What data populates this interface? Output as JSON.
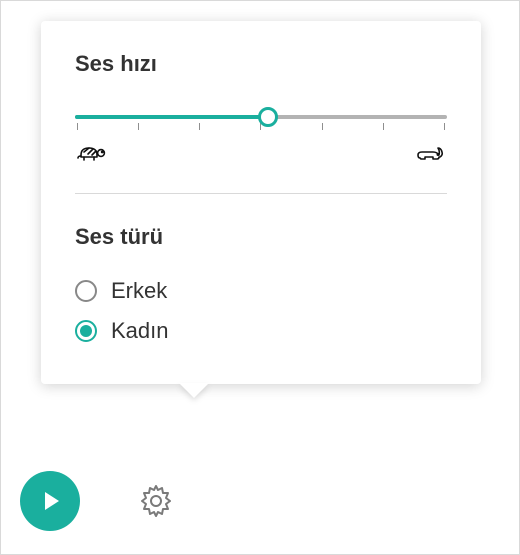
{
  "colors": {
    "accent": "#1aaf9e",
    "text": "#333333",
    "track": "#b3b3b3"
  },
  "speed": {
    "title": "Ses hızı",
    "value_percent": 52,
    "ticks": 7,
    "slow_icon": "turtle-icon",
    "fast_icon": "rabbit-icon"
  },
  "voice": {
    "title": "Ses türü",
    "options": [
      {
        "id": "male",
        "label": "Erkek",
        "selected": false
      },
      {
        "id": "female",
        "label": "Kadın",
        "selected": true
      }
    ]
  },
  "controls": {
    "play_icon": "play-icon",
    "settings_icon": "gear-icon"
  }
}
